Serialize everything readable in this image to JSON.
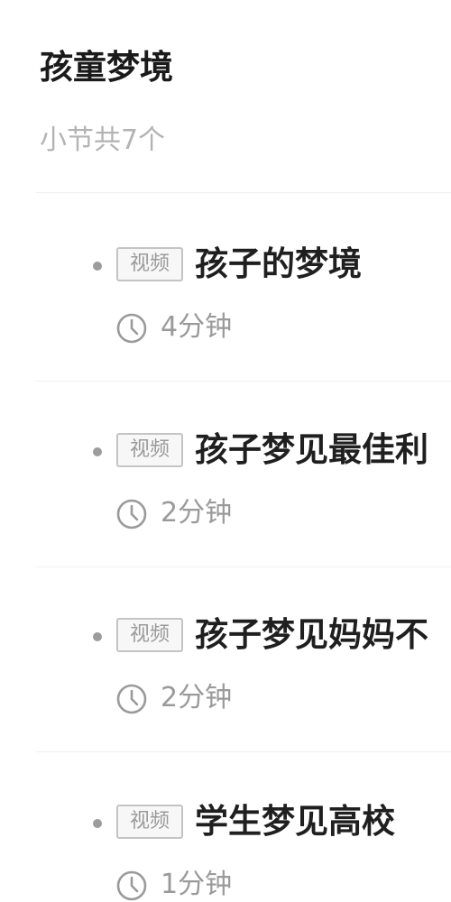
{
  "course": {
    "title": "孩童梦境",
    "lesson_count": "小节共7个"
  },
  "icons": {
    "bullet": "dot-icon",
    "duration": "clock-icon"
  },
  "colors": {
    "title": "#1a1a1a",
    "muted": "#9a9a9a",
    "tag_border": "#c4c4c4"
  },
  "lessons": [
    {
      "tag": "视频",
      "title": "孩子的梦境",
      "duration": "4分钟"
    },
    {
      "tag": "视频",
      "title": "孩子梦见最佳利",
      "duration": "2分钟"
    },
    {
      "tag": "视频",
      "title": "孩子梦见妈妈不",
      "duration": "2分钟"
    },
    {
      "tag": "视频",
      "title": "学生梦见高校",
      "duration": "1分钟"
    }
  ]
}
